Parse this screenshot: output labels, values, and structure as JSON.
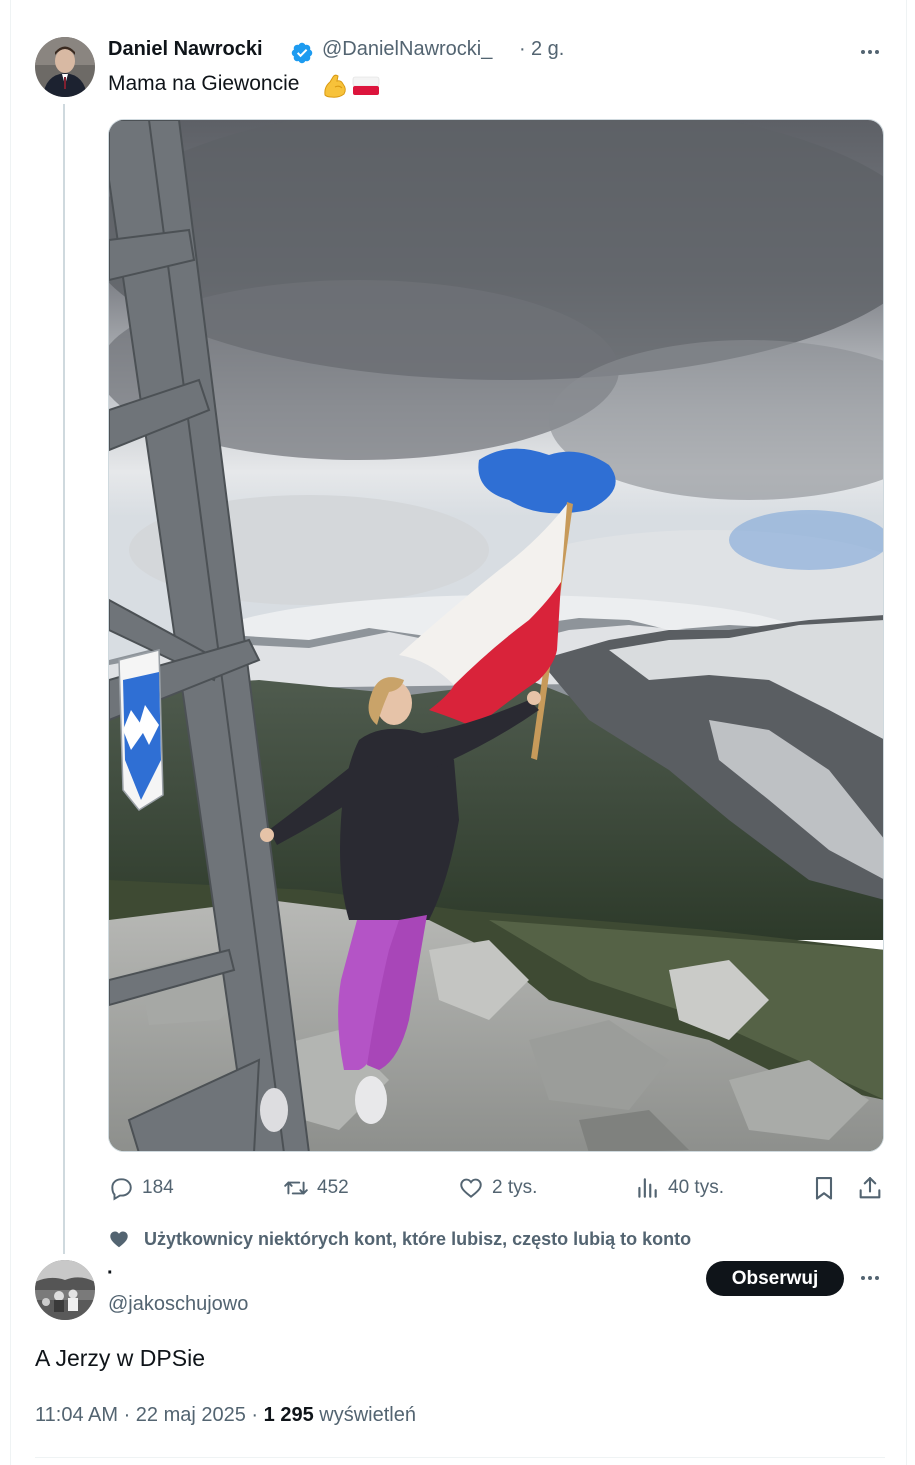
{
  "post": {
    "author_name": "Daniel Nawrocki",
    "handle": "@DanielNawrocki_",
    "separator": "·",
    "time": "2 g.",
    "text": "Mama na Giewoncie",
    "emojis": [
      "flexed-biceps",
      "poland-flag"
    ],
    "image_alt": "Woman waving the Polish flag on the rocky summit of Giewont next to the metal cross, with snowy Tatra mountains and cloudy sky in the background"
  },
  "actions": {
    "replies": "184",
    "reposts": "452",
    "likes": "2 tys.",
    "views": "40 tys."
  },
  "social_context": "Użytkownicy niektórych kont, które lubisz, często lubią to konto",
  "reply": {
    "author_name": "·",
    "handle": "@jakoschujowo",
    "follow_label": "Obserwuj",
    "text": "A Jerzy w DPSie",
    "meta_time": "11:04 AM · 22 maj 2025 · ",
    "meta_views_count": "1 295",
    "meta_views_label": " wyświetleń"
  },
  "colors": {
    "text_primary": "#0f1419",
    "text_secondary": "#536471",
    "verified_blue": "#1d9bf0",
    "border": "#cfd9de",
    "flag_white": "#f3f1ee",
    "flag_red": "#d9233a"
  }
}
